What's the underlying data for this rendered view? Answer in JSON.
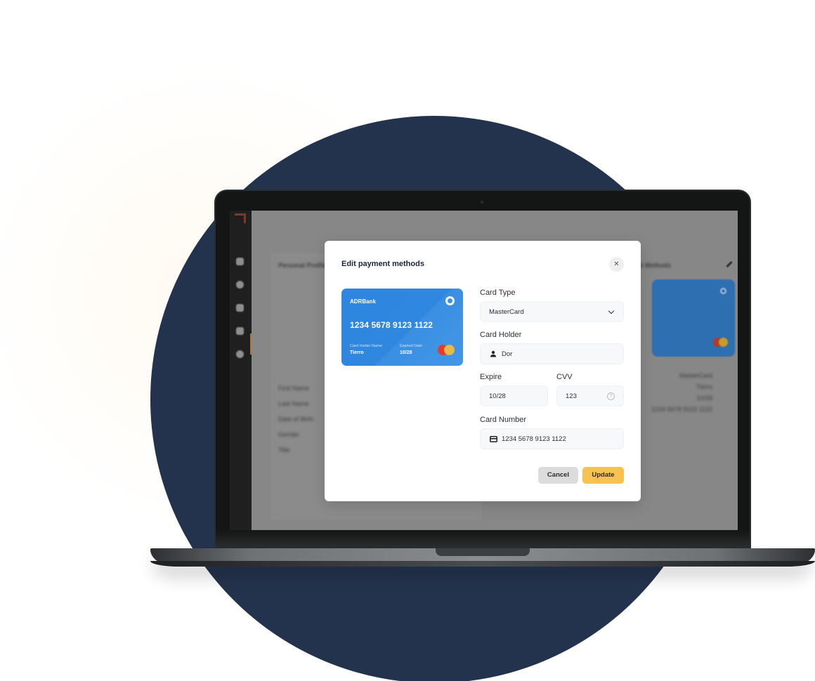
{
  "background_app": {
    "sidebar_icons": [
      "home-icon",
      "chat-icon",
      "calendar-icon",
      "document-icon",
      "settings-icon"
    ],
    "left_panel": {
      "title": "Personal Profile",
      "fields": [
        "First Name",
        "Last Name",
        "Date of Birth",
        "Gender",
        "Title"
      ]
    },
    "right_panel": {
      "title": "Payment Methods",
      "values": [
        "MasterCard",
        "Tierro",
        "10/28",
        "1234 5678 9123 1122"
      ]
    }
  },
  "modal": {
    "title": "Edit payment methods",
    "close_icon": "close-icon",
    "card_preview": {
      "bank": "ADRBank",
      "number": "1234 5678 9123 1122",
      "holder_label": "Card Holder Name",
      "holder_value": "Tierro",
      "expiry_label": "Expired Date",
      "expiry_value": "10/28",
      "network_icon": "mastercard-icon"
    },
    "form": {
      "card_type": {
        "label": "Card Type",
        "value": "MasterCard"
      },
      "card_holder": {
        "label": "Card Holder",
        "value": "Dor",
        "icon": "user-icon"
      },
      "expire": {
        "label": "Expire",
        "value": "10/28"
      },
      "cvv": {
        "label": "CVV",
        "value": "123",
        "icon": "help-icon"
      },
      "card_number": {
        "label": "Card Number",
        "value": "1234 5678 9123 1122",
        "icon": "credit-card-icon"
      }
    },
    "buttons": {
      "cancel": "Cancel",
      "update": "Update"
    }
  },
  "colors": {
    "circle": "#24334d",
    "card_blue": "#2e86de",
    "update_button": "#f8c250",
    "cancel_button": "#dcdcdc"
  }
}
